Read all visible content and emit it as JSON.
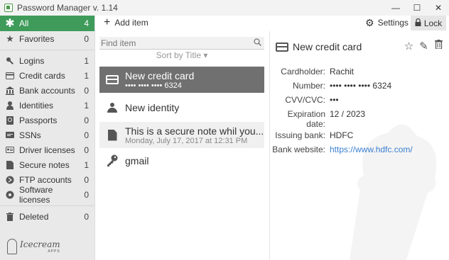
{
  "window": {
    "title": "Password Manager v. 1.14",
    "controls": {
      "minimize": "—",
      "maximize": "☐",
      "close": "✕"
    }
  },
  "toolbar": {
    "add_item": "Add item",
    "settings": "Settings",
    "lock": "Lock"
  },
  "sidebar": {
    "items": [
      {
        "label": "All",
        "count": "4",
        "icon": "asterisk-icon",
        "active": true
      },
      {
        "label": "Favorites",
        "count": "0",
        "icon": "star-icon"
      },
      {
        "label": "Logins",
        "count": "1",
        "icon": "key-icon"
      },
      {
        "label": "Credit cards",
        "count": "1",
        "icon": "credit-card-icon"
      },
      {
        "label": "Bank accounts",
        "count": "0",
        "icon": "bank-icon"
      },
      {
        "label": "Identities",
        "count": "1",
        "icon": "person-icon"
      },
      {
        "label": "Passports",
        "count": "0",
        "icon": "passport-icon"
      },
      {
        "label": "SSNs",
        "count": "0",
        "icon": "ssn-card-icon"
      },
      {
        "label": "Driver licenses",
        "count": "0",
        "icon": "driver-license-icon"
      },
      {
        "label": "Secure notes",
        "count": "1",
        "icon": "note-icon"
      },
      {
        "label": "FTP accounts",
        "count": "0",
        "icon": "ftp-icon"
      },
      {
        "label": "Software licenses",
        "count": "0",
        "icon": "software-license-icon"
      },
      {
        "label": "Deleted",
        "count": "0",
        "icon": "trash-icon"
      }
    ],
    "logo": {
      "text": "Icecream",
      "sub": "APPS"
    }
  },
  "list": {
    "search_placeholder": "Find item",
    "sort_label": "Sort by Title ▾",
    "items": [
      {
        "title": "New credit card",
        "subtitle": "•••• •••• •••• 6324",
        "icon": "credit-card-icon",
        "selected": true
      },
      {
        "title": "New identity",
        "subtitle": "",
        "icon": "person-icon"
      },
      {
        "title": "This is a secure note whil you...",
        "subtitle": "Monday, July 17, 2017 at 12:31 PM",
        "icon": "note-icon"
      },
      {
        "title": "gmail",
        "subtitle": "",
        "icon": "key-icon"
      }
    ]
  },
  "detail": {
    "title": "New credit card",
    "fields": [
      {
        "label": "Cardholder:",
        "value": "Rachit"
      },
      {
        "label": "Number:",
        "value": "•••• •••• •••• 6324"
      },
      {
        "label": "CVV/CVC:",
        "value": "•••"
      },
      {
        "label": "Expiration date:",
        "value": "12 / 2023"
      },
      {
        "label": "Issuing bank:",
        "value": "HDFC"
      },
      {
        "label": "Bank website:",
        "value": "https://www.hdfc.com/"
      }
    ]
  },
  "colors": {
    "accent": "#3e9b5a",
    "selected_row": "#707070",
    "link": "#3a7fd0"
  }
}
